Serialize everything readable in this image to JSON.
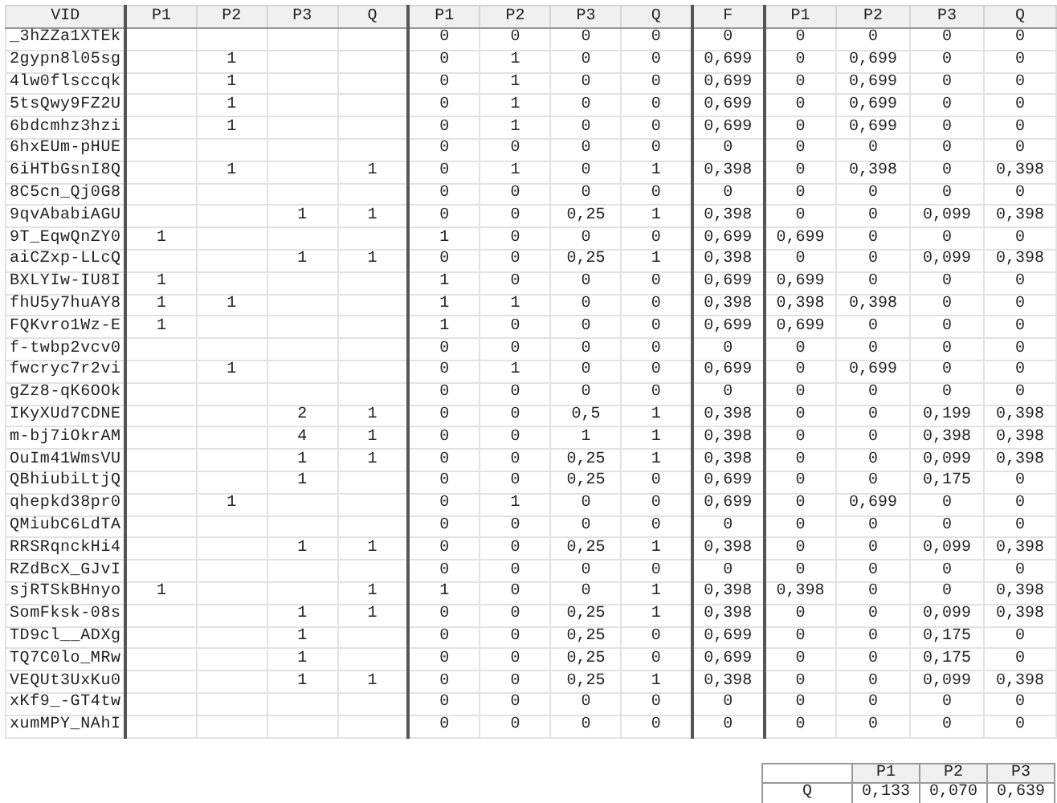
{
  "main_table": {
    "column_groups": [
      {
        "columns": [
          "VID"
        ]
      },
      {
        "columns": [
          "P1",
          "P2",
          "P3",
          "Q"
        ]
      },
      {
        "columns": [
          "P1",
          "P2",
          "P3",
          "Q"
        ]
      },
      {
        "columns": [
          "F"
        ]
      },
      {
        "columns": [
          "P1",
          "P2",
          "P3",
          "Q"
        ]
      }
    ],
    "rows": [
      {
        "vid": "_3hZZa1XTEk",
        "counts": {},
        "binary": [
          "0",
          "0",
          "0",
          "0"
        ],
        "f": "0",
        "weights": [
          "0",
          "0",
          "0",
          "0"
        ]
      },
      {
        "vid": "2gypn8l05sg",
        "counts": {
          "p2": "1"
        },
        "binary": [
          "0",
          "1",
          "0",
          "0"
        ],
        "f": "0,699",
        "weights": [
          "0",
          "0,699",
          "0",
          "0"
        ]
      },
      {
        "vid": "4lw0flsccqk",
        "counts": {
          "p2": "1"
        },
        "binary": [
          "0",
          "1",
          "0",
          "0"
        ],
        "f": "0,699",
        "weights": [
          "0",
          "0,699",
          "0",
          "0"
        ]
      },
      {
        "vid": "5tsQwy9FZ2U",
        "counts": {
          "p2": "1"
        },
        "binary": [
          "0",
          "1",
          "0",
          "0"
        ],
        "f": "0,699",
        "weights": [
          "0",
          "0,699",
          "0",
          "0"
        ]
      },
      {
        "vid": "6bdcmhz3hzi",
        "counts": {
          "p2": "1"
        },
        "binary": [
          "0",
          "1",
          "0",
          "0"
        ],
        "f": "0,699",
        "weights": [
          "0",
          "0,699",
          "0",
          "0"
        ]
      },
      {
        "vid": "6hxEUm-pHUE",
        "counts": {},
        "binary": [
          "0",
          "0",
          "0",
          "0"
        ],
        "f": "0",
        "weights": [
          "0",
          "0",
          "0",
          "0"
        ]
      },
      {
        "vid": "6iHTbGsnI8Q",
        "counts": {
          "p2": "1",
          "q": "1"
        },
        "binary": [
          "0",
          "1",
          "0",
          "1"
        ],
        "f": "0,398",
        "weights": [
          "0",
          "0,398",
          "0",
          "0,398"
        ]
      },
      {
        "vid": "8C5cn_Qj0G8",
        "counts": {},
        "binary": [
          "0",
          "0",
          "0",
          "0"
        ],
        "f": "0",
        "weights": [
          "0",
          "0",
          "0",
          "0"
        ]
      },
      {
        "vid": "9qvAbabiAGU",
        "counts": {
          "p3": "1",
          "q": "1"
        },
        "binary": [
          "0",
          "0",
          "0,25",
          "1"
        ],
        "f": "0,398",
        "weights": [
          "0",
          "0",
          "0,099",
          "0,398"
        ]
      },
      {
        "vid": "9T_EqwQnZY0",
        "counts": {
          "p1": "1"
        },
        "binary": [
          "1",
          "0",
          "0",
          "0"
        ],
        "f": "0,699",
        "weights": [
          "0,699",
          "0",
          "0",
          "0"
        ]
      },
      {
        "vid": "aiCZxp-LLcQ",
        "counts": {
          "p3": "1",
          "q": "1"
        },
        "binary": [
          "0",
          "0",
          "0,25",
          "1"
        ],
        "f": "0,398",
        "weights": [
          "0",
          "0",
          "0,099",
          "0,398"
        ]
      },
      {
        "vid": "BXLYIw-IU8I",
        "counts": {
          "p1": "1"
        },
        "binary": [
          "1",
          "0",
          "0",
          "0"
        ],
        "f": "0,699",
        "weights": [
          "0,699",
          "0",
          "0",
          "0"
        ]
      },
      {
        "vid": "fhU5y7huAY8",
        "counts": {
          "p1": "1",
          "p2": "1"
        },
        "binary": [
          "1",
          "1",
          "0",
          "0"
        ],
        "f": "0,398",
        "weights": [
          "0,398",
          "0,398",
          "0",
          "0"
        ]
      },
      {
        "vid": "FQKvro1Wz-E",
        "counts": {
          "p1": "1"
        },
        "binary": [
          "1",
          "0",
          "0",
          "0"
        ],
        "f": "0,699",
        "weights": [
          "0,699",
          "0",
          "0",
          "0"
        ]
      },
      {
        "vid": "f-twbp2vcv0",
        "counts": {},
        "binary": [
          "0",
          "0",
          "0",
          "0"
        ],
        "f": "0",
        "weights": [
          "0",
          "0",
          "0",
          "0"
        ]
      },
      {
        "vid": "fwcryc7r2vi",
        "counts": {
          "p2": "1"
        },
        "binary": [
          "0",
          "1",
          "0",
          "0"
        ],
        "f": "0,699",
        "weights": [
          "0",
          "0,699",
          "0",
          "0"
        ]
      },
      {
        "vid": "gZz8-qK6OOk",
        "counts": {},
        "binary": [
          "0",
          "0",
          "0",
          "0"
        ],
        "f": "0",
        "weights": [
          "0",
          "0",
          "0",
          "0"
        ]
      },
      {
        "vid": "IKyXUd7CDNE",
        "counts": {
          "p3": "2",
          "q": "1"
        },
        "binary": [
          "0",
          "0",
          "0,5",
          "1"
        ],
        "f": "0,398",
        "weights": [
          "0",
          "0",
          "0,199",
          "0,398"
        ]
      },
      {
        "vid": "m-bj7iOkrAM",
        "counts": {
          "p3": "4",
          "q": "1"
        },
        "binary": [
          "0",
          "0",
          "1",
          "1"
        ],
        "f": "0,398",
        "weights": [
          "0",
          "0",
          "0,398",
          "0,398"
        ]
      },
      {
        "vid": "OuIm41WmsVU",
        "counts": {
          "p3": "1",
          "q": "1"
        },
        "binary": [
          "0",
          "0",
          "0,25",
          "1"
        ],
        "f": "0,398",
        "weights": [
          "0",
          "0",
          "0,099",
          "0,398"
        ]
      },
      {
        "vid": "QBhiubiLtjQ",
        "counts": {
          "p3": "1"
        },
        "binary": [
          "0",
          "0",
          "0,25",
          "0"
        ],
        "f": "0,699",
        "weights": [
          "0",
          "0",
          "0,175",
          "0"
        ]
      },
      {
        "vid": "qhepkd38pr0",
        "counts": {
          "p2": "1"
        },
        "binary": [
          "0",
          "1",
          "0",
          "0"
        ],
        "f": "0,699",
        "weights": [
          "0",
          "0,699",
          "0",
          "0"
        ]
      },
      {
        "vid": "QMiubC6LdTA",
        "counts": {},
        "binary": [
          "0",
          "0",
          "0",
          "0"
        ],
        "f": "0",
        "weights": [
          "0",
          "0",
          "0",
          "0"
        ]
      },
      {
        "vid": "RRSRqnckHi4",
        "counts": {
          "p3": "1",
          "q": "1"
        },
        "binary": [
          "0",
          "0",
          "0,25",
          "1"
        ],
        "f": "0,398",
        "weights": [
          "0",
          "0",
          "0,099",
          "0,398"
        ]
      },
      {
        "vid": "RZdBcX_GJvI",
        "counts": {},
        "binary": [
          "0",
          "0",
          "0",
          "0"
        ],
        "f": "0",
        "weights": [
          "0",
          "0",
          "0",
          "0"
        ]
      },
      {
        "vid": "sjRTSkBHnyo",
        "counts": {
          "p1": "1",
          "q": "1"
        },
        "binary": [
          "1",
          "0",
          "0",
          "1"
        ],
        "f": "0,398",
        "weights": [
          "0,398",
          "0",
          "0",
          "0,398"
        ]
      },
      {
        "vid": "SomFksk-08s",
        "counts": {
          "p3": "1",
          "q": "1"
        },
        "binary": [
          "0",
          "0",
          "0,25",
          "1"
        ],
        "f": "0,398",
        "weights": [
          "0",
          "0",
          "0,099",
          "0,398"
        ]
      },
      {
        "vid": "TD9cl__ADXg",
        "counts": {
          "p3": "1"
        },
        "binary": [
          "0",
          "0",
          "0,25",
          "0"
        ],
        "f": "0,699",
        "weights": [
          "0",
          "0",
          "0,175",
          "0"
        ]
      },
      {
        "vid": "TQ7C0lo_MRw",
        "counts": {
          "p3": "1"
        },
        "binary": [
          "0",
          "0",
          "0,25",
          "0"
        ],
        "f": "0,699",
        "weights": [
          "0",
          "0",
          "0,175",
          "0"
        ]
      },
      {
        "vid": "VEQUt3UxKu0",
        "counts": {
          "p3": "1",
          "q": "1"
        },
        "binary": [
          "0",
          "0",
          "0,25",
          "1"
        ],
        "f": "0,398",
        "weights": [
          "0",
          "0",
          "0,099",
          "0,398"
        ]
      },
      {
        "vid": "xKf9_-GT4tw",
        "counts": {},
        "binary": [
          "0",
          "0",
          "0",
          "0"
        ],
        "f": "0",
        "weights": [
          "0",
          "0",
          "0",
          "0"
        ]
      },
      {
        "vid": "xumMPY_NAhI",
        "counts": {},
        "binary": [
          "0",
          "0",
          "0",
          "0"
        ],
        "f": "0",
        "weights": [
          "0",
          "0",
          "0",
          "0"
        ]
      }
    ]
  },
  "summary_table": {
    "columns": [
      "P1",
      "P2",
      "P3"
    ],
    "rows": [
      {
        "label": "Q",
        "values": [
          "0,133",
          "0,070",
          "0,639"
        ]
      }
    ]
  }
}
